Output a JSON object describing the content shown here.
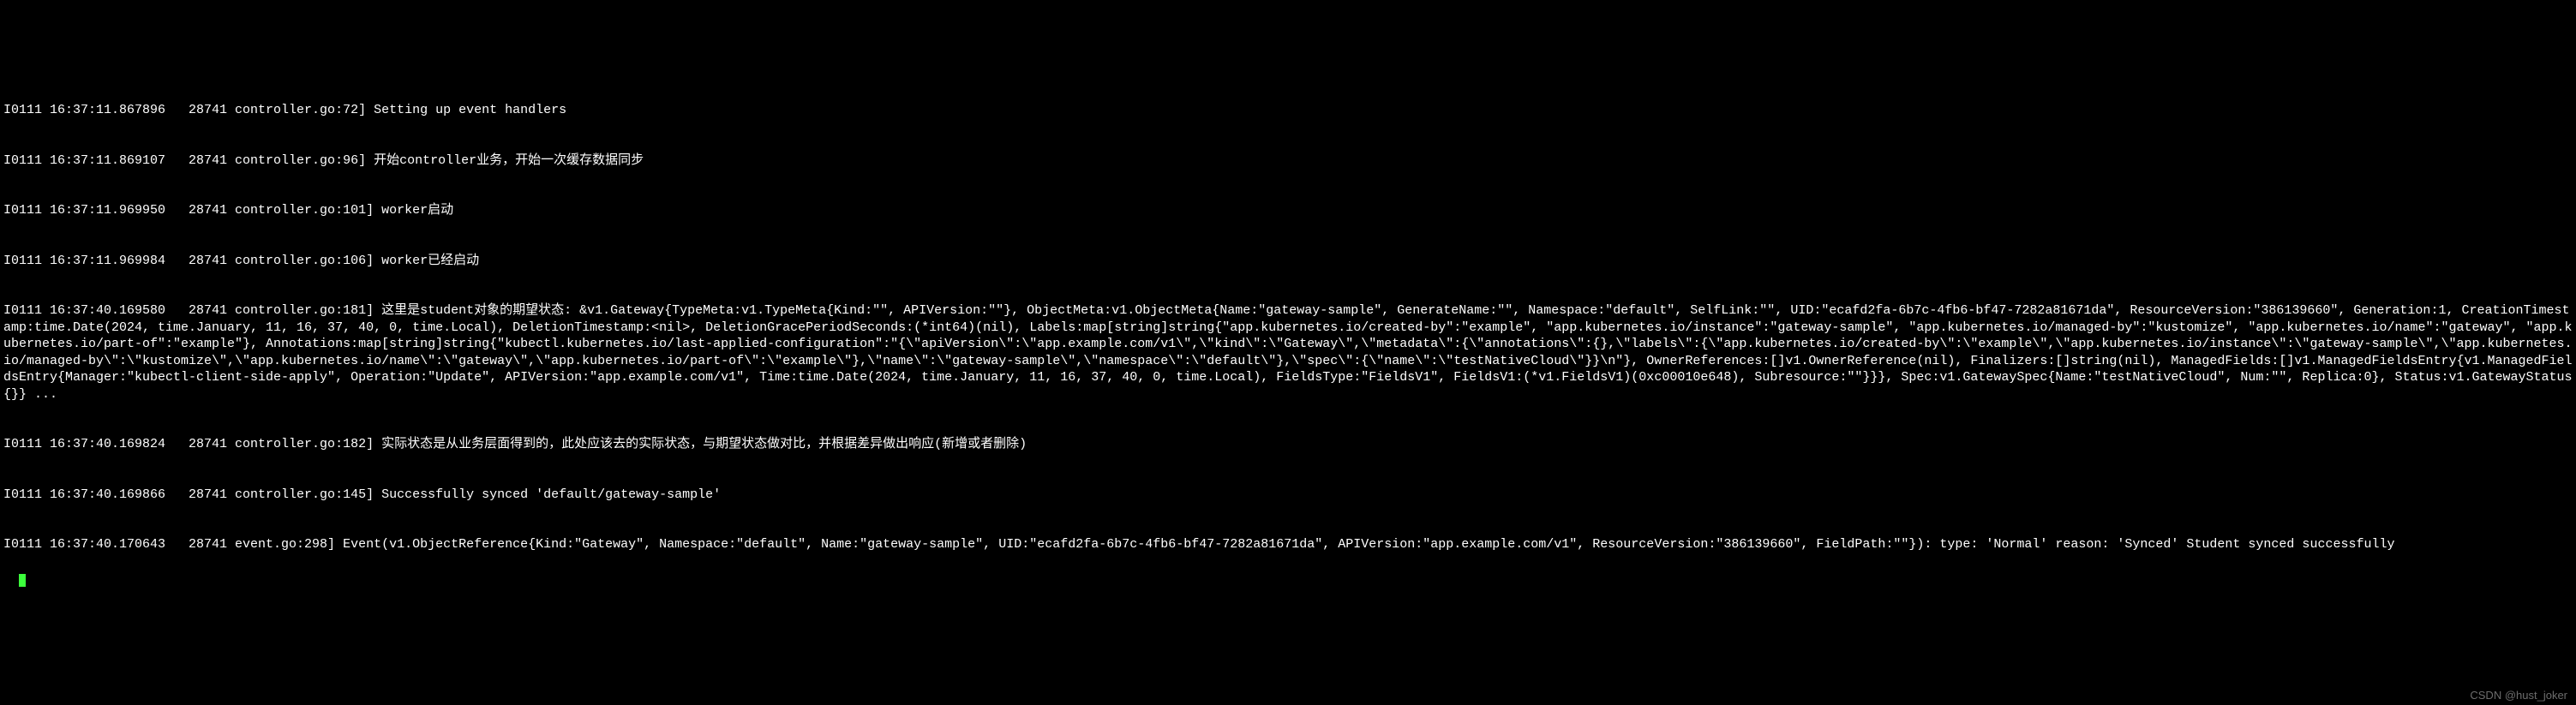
{
  "lines": [
    "I0111 16:37:11.867896   28741 controller.go:72] Setting up event handlers",
    "I0111 16:37:11.869107   28741 controller.go:96] 开始controller业务，开始一次缓存数据同步",
    "I0111 16:37:11.969950   28741 controller.go:101] worker启动",
    "I0111 16:37:11.969984   28741 controller.go:106] worker已经启动",
    "I0111 16:37:40.169580   28741 controller.go:181] 这里是student对象的期望状态: &v1.Gateway{TypeMeta:v1.TypeMeta{Kind:\"\", APIVersion:\"\"}, ObjectMeta:v1.ObjectMeta{Name:\"gateway-sample\", GenerateName:\"\", Namespace:\"default\", SelfLink:\"\", UID:\"ecafd2fa-6b7c-4fb6-bf47-7282a81671da\", ResourceVersion:\"386139660\", Generation:1, CreationTimestamp:time.Date(2024, time.January, 11, 16, 37, 40, 0, time.Local), DeletionTimestamp:<nil>, DeletionGracePeriodSeconds:(*int64)(nil), Labels:map[string]string{\"app.kubernetes.io/created-by\":\"example\", \"app.kubernetes.io/instance\":\"gateway-sample\", \"app.kubernetes.io/managed-by\":\"kustomize\", \"app.kubernetes.io/name\":\"gateway\", \"app.kubernetes.io/part-of\":\"example\"}, Annotations:map[string]string{\"kubectl.kubernetes.io/last-applied-configuration\":\"{\\\"apiVersion\\\":\\\"app.example.com/v1\\\",\\\"kind\\\":\\\"Gateway\\\",\\\"metadata\\\":{\\\"annotations\\\":{},\\\"labels\\\":{\\\"app.kubernetes.io/created-by\\\":\\\"example\\\",\\\"app.kubernetes.io/instance\\\":\\\"gateway-sample\\\",\\\"app.kubernetes.io/managed-by\\\":\\\"kustomize\\\",\\\"app.kubernetes.io/name\\\":\\\"gateway\\\",\\\"app.kubernetes.io/part-of\\\":\\\"example\\\"},\\\"name\\\":\\\"gateway-sample\\\",\\\"namespace\\\":\\\"default\\\"},\\\"spec\\\":{\\\"name\\\":\\\"testNativeCloud\\\"}}\\n\"}, OwnerReferences:[]v1.OwnerReference(nil), Finalizers:[]string(nil), ManagedFields:[]v1.ManagedFieldsEntry{v1.ManagedFieldsEntry{Manager:\"kubectl-client-side-apply\", Operation:\"Update\", APIVersion:\"app.example.com/v1\", Time:time.Date(2024, time.January, 11, 16, 37, 40, 0, time.Local), FieldsType:\"FieldsV1\", FieldsV1:(*v1.FieldsV1)(0xc00010e648), Subresource:\"\"}}}, Spec:v1.GatewaySpec{Name:\"testNativeCloud\", Num:\"\", Replica:0}, Status:v1.GatewayStatus{}} ...",
    "I0111 16:37:40.169824   28741 controller.go:182] 实际状态是从业务层面得到的，此处应该去的实际状态，与期望状态做对比，并根据差异做出响应(新增或者删除)",
    "I0111 16:37:40.169866   28741 controller.go:145] Successfully synced 'default/gateway-sample'",
    "I0111 16:37:40.170643   28741 event.go:298] Event(v1.ObjectReference{Kind:\"Gateway\", Namespace:\"default\", Name:\"gateway-sample\", UID:\"ecafd2fa-6b7c-4fb6-bf47-7282a81671da\", APIVersion:\"app.example.com/v1\", ResourceVersion:\"386139660\", FieldPath:\"\"}): type: 'Normal' reason: 'Synced' Student synced successfully"
  ],
  "watermark": "CSDN @hust_joker"
}
